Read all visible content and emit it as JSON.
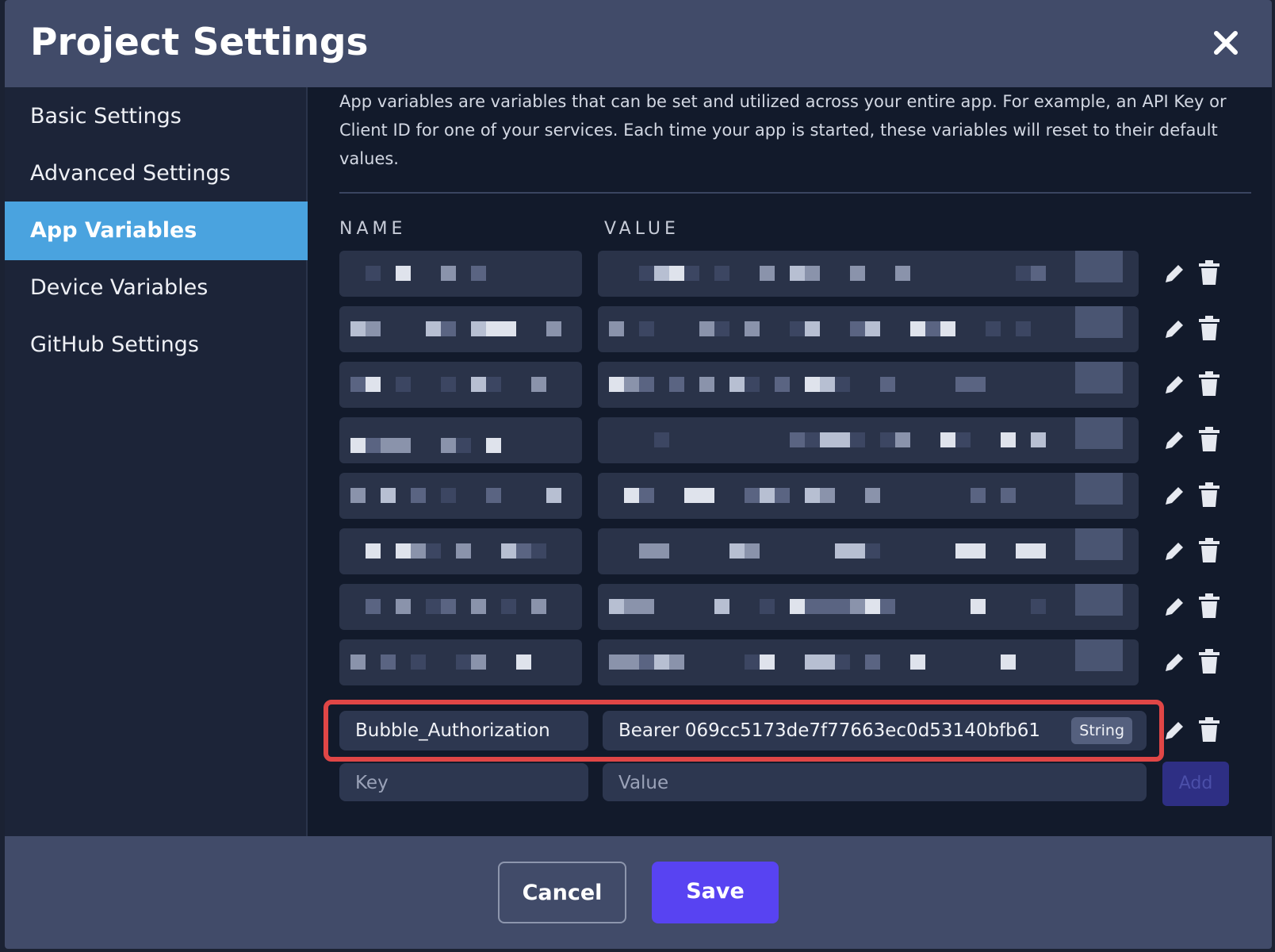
{
  "modal": {
    "title": "Project Settings"
  },
  "sidebar": {
    "items": [
      {
        "label": "Basic Settings",
        "active": false
      },
      {
        "label": "Advanced Settings",
        "active": false
      },
      {
        "label": "App Variables",
        "active": true
      },
      {
        "label": "Device Variables",
        "active": false
      },
      {
        "label": "GitHub Settings",
        "active": false
      }
    ]
  },
  "content": {
    "description": "App variables are variables that can be set and utilized across your entire app. For example, an API Key or Client ID for one of your services. Each time your app is started, these variables will reset to their default values.",
    "columns": {
      "name": "NAME",
      "value": "VALUE"
    },
    "highlighted_variable": {
      "key": "Bubble_Authorization",
      "value": "Bearer 069cc5173de7f77663ec0d53140bfb61",
      "type": "String"
    },
    "new_variable": {
      "key_placeholder": "Key",
      "value_placeholder": "Value",
      "add_label": "Add"
    }
  },
  "footer": {
    "cancel_label": "Cancel",
    "save_label": "Save"
  },
  "colors": {
    "header_bg": "#414b69",
    "active_tab": "#4aa3df",
    "save_button": "#5843f2",
    "highlight_border": "#e04646"
  }
}
